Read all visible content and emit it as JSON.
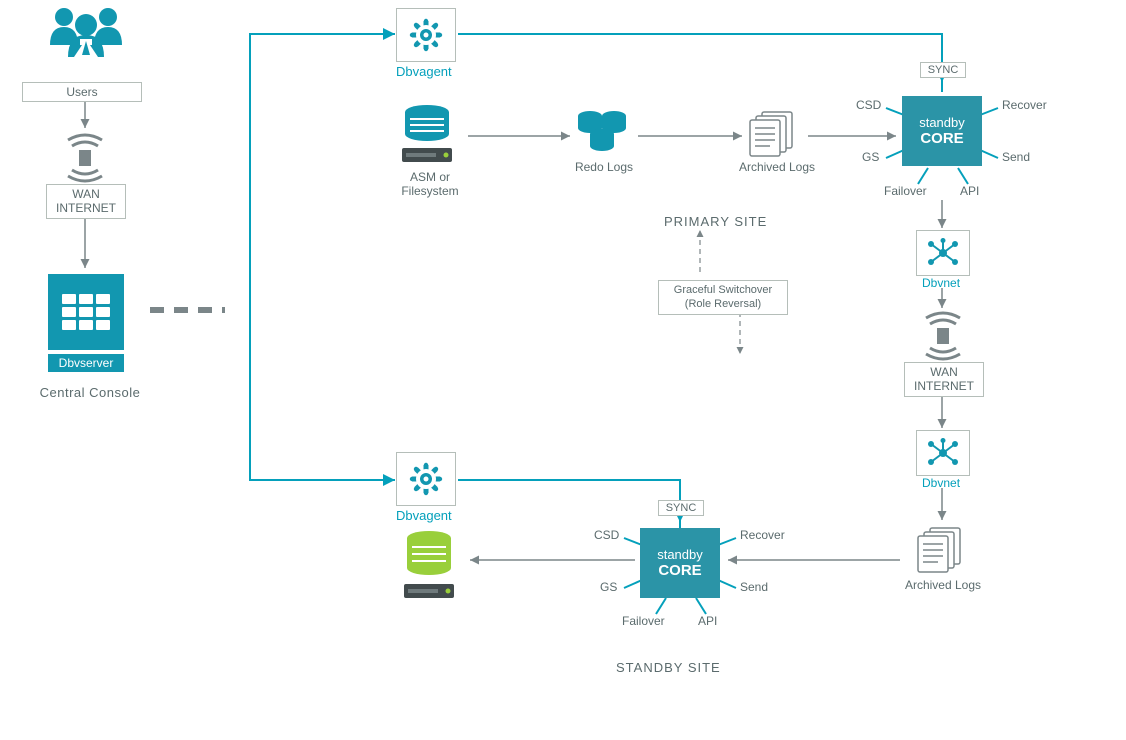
{
  "users_label": "Users",
  "wan_label": "WAN\nINTERNET",
  "wan_label2": "WAN\nINTERNET",
  "dbvserver_label": "Dbvserver",
  "central_console": "Central Console",
  "dbvagent1": "Dbvagent",
  "dbvagent2": "Dbvagent",
  "asm_label": "ASM or\nFilesystem",
  "redo_logs": "Redo Logs",
  "archived_logs": "Archived Logs",
  "archived_logs2": "Archived Logs",
  "dbvnet1": "Dbvnet",
  "dbvnet2": "Dbvnet",
  "primary_site": "PRIMARY SITE",
  "standby_site": "STANDBY SITE",
  "switchover": "Graceful Switchover\n(Role Reversal)",
  "core_l1": "standby",
  "core_l2": "CORE",
  "spokes": {
    "sync": "SYNC",
    "csd": "CSD",
    "gs": "GS",
    "recover": "Recover",
    "send": "Send",
    "failover": "Failover",
    "api": "API"
  }
}
